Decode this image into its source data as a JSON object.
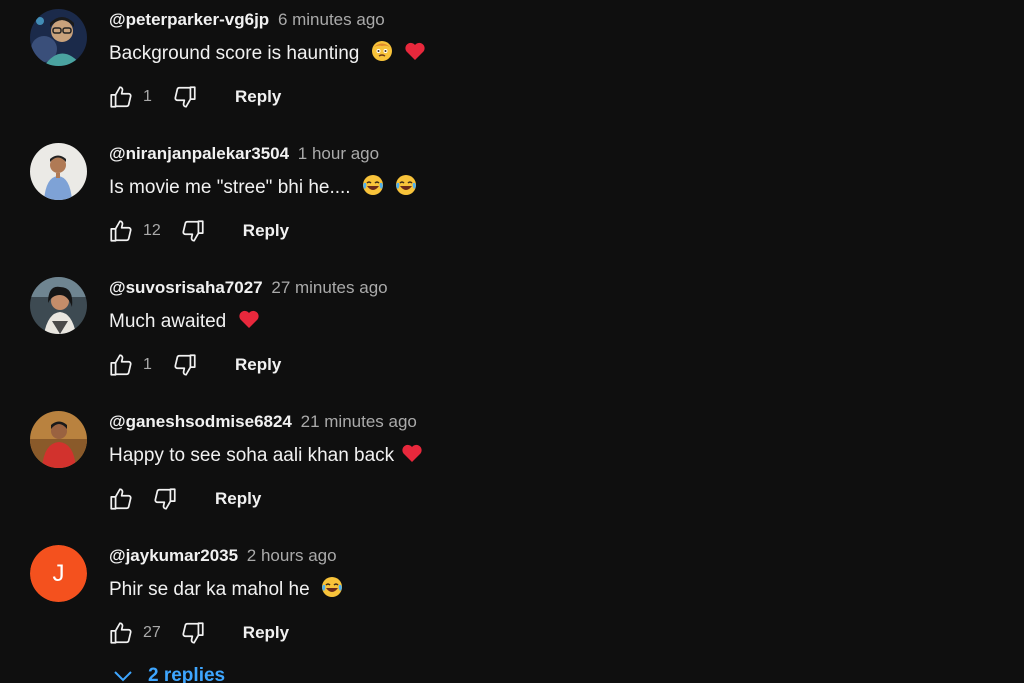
{
  "comments": [
    {
      "author": "@peterparker-vg6jp",
      "time": "6 minutes ago",
      "text": "Background score is haunting",
      "emojis": [
        "face-emoji",
        "red-heart-emoji"
      ],
      "likes": "1",
      "reply_label": "Reply"
    },
    {
      "author": "@niranjanpalekar3504",
      "time": "1 hour ago",
      "text": "Is movie me \"stree\" bhi he....",
      "emojis": [
        "laughing-tears-emoji",
        "laughing-tears-emoji"
      ],
      "likes": "12",
      "reply_label": "Reply"
    },
    {
      "author": "@suvosrisaha7027",
      "time": "27 minutes ago",
      "text": "Much awaited",
      "emojis": [
        "red-heart-emoji"
      ],
      "likes": "1",
      "reply_label": "Reply"
    },
    {
      "author": "@ganeshsodmise6824",
      "time": "21 minutes ago",
      "text": "Happy to see soha aali khan back",
      "emojis": [
        "red-heart-emoji"
      ],
      "likes": "",
      "reply_label": "Reply"
    },
    {
      "author": "@jaykumar2035",
      "time": "2 hours ago",
      "text": "Phir se dar ka mahol he",
      "emojis": [
        "laughing-tears-emoji"
      ],
      "likes": "27",
      "reply_label": "Reply",
      "avatar_letter": "J",
      "avatar_color": "#f4511e"
    }
  ],
  "replies_toggle": {
    "label": "2 replies",
    "icon": "chevron-down-icon"
  },
  "colors": {
    "background": "#0f0f0f",
    "text_primary": "#f1f1f1",
    "text_secondary": "#aaaaaa",
    "link_blue": "#3ea6ff",
    "heart_red": "#e8283c"
  }
}
